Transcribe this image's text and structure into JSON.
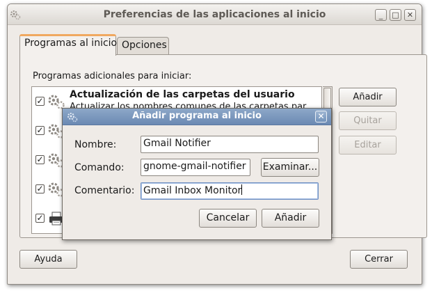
{
  "window": {
    "title": "Preferencias de las aplicaciones al inicio",
    "controls": {
      "minimize": "_",
      "maximize": "□",
      "close": "✕"
    }
  },
  "tabs": [
    {
      "label": "Programas al inicio",
      "active": true
    },
    {
      "label": "Opciones",
      "active": false
    }
  ],
  "programs_panel": {
    "label": "Programas adicionales para iniciar:",
    "items": [
      {
        "checked": true,
        "name": "Actualización de las carpetas del usuario",
        "description": "Actualizar los nombres comunes de las carpetas par...",
        "icon": "gears-icon"
      },
      {
        "checked": true,
        "name": "",
        "description": "",
        "icon": "gears-icon"
      },
      {
        "checked": true,
        "name": "",
        "description": "",
        "icon": "gears-icon"
      },
      {
        "checked": true,
        "name": "",
        "description": "",
        "icon": "gears-icon"
      },
      {
        "checked": true,
        "name": "",
        "description": "",
        "icon": "printer-icon"
      }
    ],
    "buttons": {
      "add": "Añadir",
      "remove": "Quitar",
      "edit": "Editar"
    }
  },
  "footer": {
    "help": "Ayuda",
    "close": "Cerrar"
  },
  "dialog": {
    "title": "Añadir programa al inicio",
    "close_glyph": "✕",
    "name_label": "Nombre:",
    "name_value": "Gmail Notifier",
    "command_label": "Comando:",
    "command_value": "gnome-gmail-notifier",
    "browse": "Examinar...",
    "comment_label": "Comentario:",
    "comment_value": "Gmail Inbox Monitor",
    "cancel": "Cancelar",
    "add": "Añadir"
  },
  "colors": {
    "accent_tab": "#f0a860",
    "dialog_title": "#6b89b3",
    "window_bg": "#efebe7"
  }
}
